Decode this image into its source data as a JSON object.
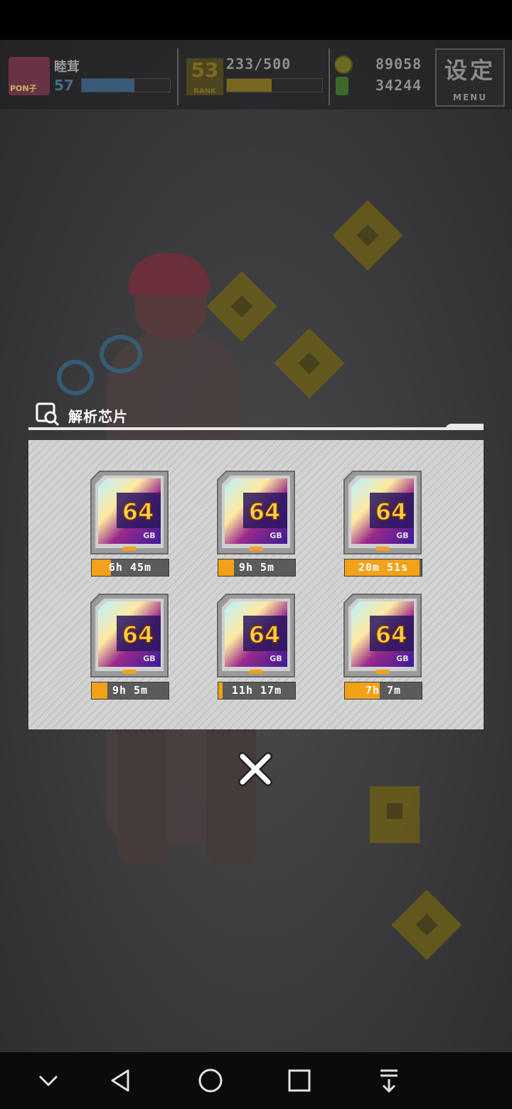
{
  "hud": {
    "player_name": "睦茸",
    "level": "57",
    "avatar_tag": "PON子",
    "level_progress": 0.6,
    "rank_number": "53",
    "rank_label": "RANK",
    "stamina": "233/500",
    "stamina_progress": 0.47,
    "coins": "89058",
    "gems": "34244",
    "menu_label": "设定",
    "menu_sublabel": "MENU"
  },
  "dialog": {
    "title": "解析芯片",
    "chips": [
      {
        "capacity": "64",
        "unit": "GB",
        "timer": "6h 45m",
        "progress": 0.25
      },
      {
        "capacity": "64",
        "unit": "GB",
        "timer": "9h 5m",
        "progress": 0.2
      },
      {
        "capacity": "64",
        "unit": "GB",
        "timer": "20m 51s",
        "progress": 0.97
      },
      {
        "capacity": "64",
        "unit": "GB",
        "timer": "9h 5m",
        "progress": 0.2
      },
      {
        "capacity": "64",
        "unit": "GB",
        "timer": "11h 17m",
        "progress": 0.06
      },
      {
        "capacity": "64",
        "unit": "GB",
        "timer": "7h 7m",
        "progress": 0.45
      }
    ],
    "close_icon": "close-x"
  },
  "navbar": {
    "icons": [
      "chevron-down",
      "back-triangle",
      "home-circle",
      "recents-square",
      "download-arrow"
    ]
  },
  "colors": {
    "timer_fill": "#f2a118",
    "panel": "#d3d3d3",
    "navbar": "#0b0b0b"
  }
}
